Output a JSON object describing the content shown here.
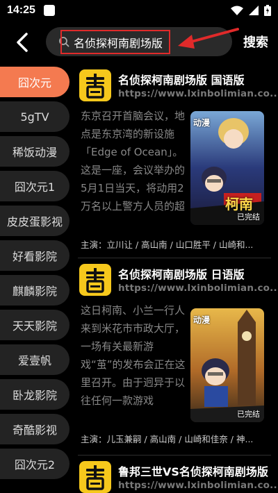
{
  "status_bar": {
    "time": "14:25"
  },
  "header": {
    "search_value": "名侦探柯南剧场版",
    "search_button": "搜索"
  },
  "sidebar": {
    "items": [
      {
        "label": "囧次元",
        "active": true
      },
      {
        "label": "5gTV"
      },
      {
        "label": "稀饭动漫"
      },
      {
        "label": "囧次元1"
      },
      {
        "label": "皮皮蛋影视"
      },
      {
        "label": "好看影院"
      },
      {
        "label": "麒麟影院"
      },
      {
        "label": "天天影院"
      },
      {
        "label": "爱壹帆"
      },
      {
        "label": "卧龙影院"
      },
      {
        "label": "奇酷影视"
      },
      {
        "label": "囧次元2"
      }
    ]
  },
  "results": [
    {
      "title": "名侦探柯南剧场版 国语版",
      "url": "https://www.lxinbolimian.co...",
      "description": "东京召开首脑会议，地点是东京湾的新设施「Edge of Ocean」。这是一座，会议举办的5月1日当天，将动用2万名以上警方人员的超巨大设施。然而不料某天，竟发生了突如其来",
      "poster_tag": "动漫",
      "poster_title": "柯南",
      "poster_status": "已完结",
      "cast": "主演：立川让 / 高山南 / 山口胜平 / 山崎和..."
    },
    {
      "title": "名侦探柯南剧场版 日语版",
      "url": "https://www.lxinbolimian.co...",
      "description": "这日柯南、小兰一行人来到米花市市政大厅，一场有关最新游戏“茧”的发布会正在这里召开。由于迥异于以往任何一款游戏的“茧”可能一举改变全球游戏业界的价值观...",
      "poster_tag": "动漫",
      "poster_status": "已完结",
      "cast": "主演：儿玉兼嗣 / 高山南 / 山崎和佳奈 / 神..."
    },
    {
      "title": "鲁邦三世VS名侦探柯南剧场版",
      "url": "https://www.lxinbolimian.co..."
    }
  ],
  "colors": {
    "accent": "#f47a50",
    "logo_yellow": "#f6c81c",
    "highlight_red": "#e02a2a"
  }
}
